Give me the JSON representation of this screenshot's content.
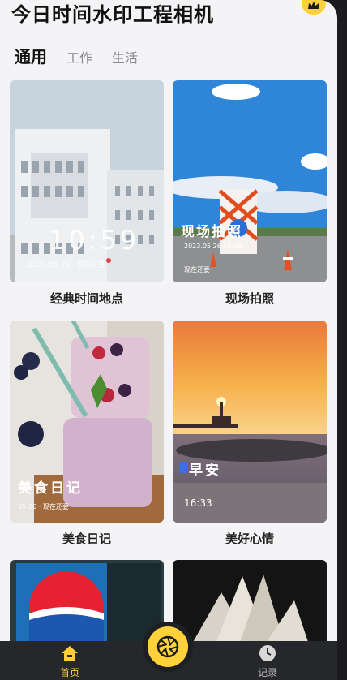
{
  "app": {
    "title": "今日时间水印工程相机"
  },
  "colors": {
    "accent": "#ffd23c",
    "background": "#f4f4f6",
    "bottom_bar": "#26272b"
  },
  "tabs": [
    {
      "label": "通用",
      "active": true
    },
    {
      "label": "工作",
      "active": false
    },
    {
      "label": "生活",
      "active": false
    }
  ],
  "templates": [
    {
      "name": "经典时间地点",
      "overlay_time": "10:59",
      "overlay_date": "2023-05-26 · 现在还要"
    },
    {
      "name": "现场拍照",
      "overlay_title": "现场拍照",
      "overlay_line1": "2023.05.26 10:59",
      "overlay_line2": "现在还要"
    },
    {
      "name": "美食日记",
      "overlay_title": "美食日记",
      "overlay_sub": "05-26 · 现在还要"
    },
    {
      "name": "美好心情",
      "overlay_title": "早安",
      "overlay_time": "16:33"
    },
    {
      "name": "pepsi-can-photo"
    },
    {
      "name": "open-book-photo"
    }
  ],
  "bottom_nav": {
    "home_label": "首页",
    "record_label": "记录",
    "home_icon": "home-icon",
    "shutter_icon": "aperture-icon",
    "record_icon": "clock-icon"
  }
}
